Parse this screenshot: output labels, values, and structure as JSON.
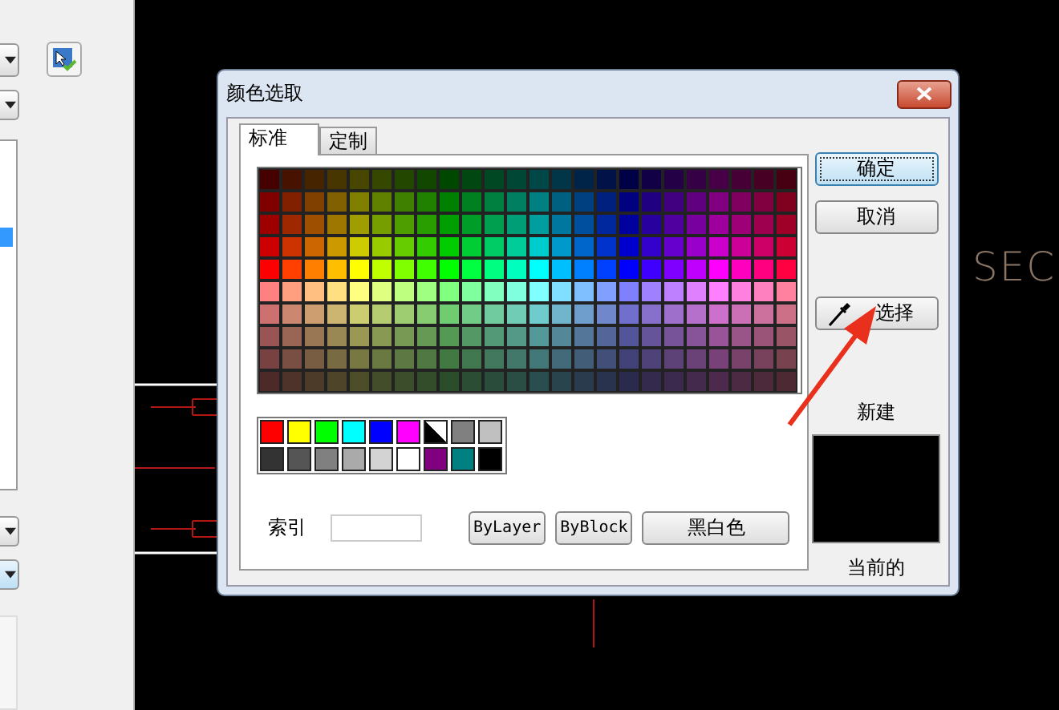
{
  "canvas": {
    "label": "SEC"
  },
  "dialog": {
    "title": "颜色选取",
    "tabs": [
      {
        "label": "标准",
        "selected": true
      },
      {
        "label": "定制",
        "selected": false
      }
    ],
    "standard_colors": [
      {
        "kind": "solid",
        "color": "#ff0000"
      },
      {
        "kind": "solid",
        "color": "#ffff00"
      },
      {
        "kind": "solid",
        "color": "#00ff00"
      },
      {
        "kind": "solid",
        "color": "#00ffff"
      },
      {
        "kind": "solid",
        "color": "#0000ff"
      },
      {
        "kind": "solid",
        "color": "#ff00ff"
      },
      {
        "kind": "split",
        "color": "#000000"
      },
      {
        "kind": "solid",
        "color": "#808080"
      },
      {
        "kind": "solid",
        "color": "#c0c0c0"
      },
      {
        "kind": "solid",
        "color": "#333333"
      },
      {
        "kind": "solid",
        "color": "#555555"
      },
      {
        "kind": "solid",
        "color": "#808080"
      },
      {
        "kind": "solid",
        "color": "#aaaaaa"
      },
      {
        "kind": "solid",
        "color": "#d3d3d3"
      },
      {
        "kind": "solid",
        "color": "#ffffff"
      },
      {
        "kind": "solid",
        "color": "#800080"
      },
      {
        "kind": "solid",
        "color": "#008080"
      },
      {
        "kind": "solid",
        "color": "#000000"
      }
    ],
    "index_label": "索引",
    "bottom_buttons": [
      "ByLayer",
      "ByBlock",
      "黑白色"
    ],
    "ok_button": "确定",
    "cancel_button": "取消",
    "pick_button": "选择",
    "new_label": "新建",
    "current_label": "当前的"
  }
}
